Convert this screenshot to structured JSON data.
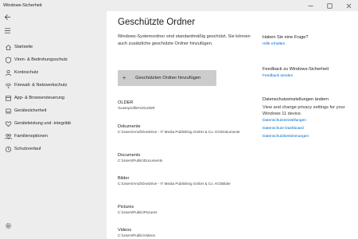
{
  "window": {
    "title": "Windows-Sicherheit"
  },
  "sidebar": {
    "items": [
      {
        "label": "Startseite",
        "icon": "home-icon"
      },
      {
        "label": "Viren- & Bedrohungsschutz",
        "icon": "shield-icon"
      },
      {
        "label": "Kontoschutz",
        "icon": "person-icon"
      },
      {
        "label": "Firewall- & Netzwerkschutz",
        "icon": "wifi-icon"
      },
      {
        "label": "App- & Browsersteuerung",
        "icon": "app-icon"
      },
      {
        "label": "Gerätesicherheit",
        "icon": "laptop-icon"
      },
      {
        "label": "Geräteleistung und -integrität",
        "icon": "heart-icon"
      },
      {
        "label": "Familienoptionen",
        "icon": "family-icon"
      },
      {
        "label": "Schutzverlauf",
        "icon": "history-icon"
      }
    ]
  },
  "main": {
    "title": "Geschützte Ordner",
    "description": "Windows-Systemordner sind standardmäßig geschützt. Sie können auch zusätzliche geschützte Ordner hinzufügen.",
    "add_button": "Geschützten Ordner hinzufügen",
    "folders": [
      {
        "name": "OLDER",
        "path": "%userprofile%\\OLDER"
      },
      {
        "name": "Dokumente",
        "path": "C:\\Users\\Amd\\OneDrive - IT Media Publishing GmbH & Co. KG\\Dokumente"
      },
      {
        "name": "Documents",
        "path": "C:\\Users\\Public\\Documents"
      },
      {
        "name": "Bilder",
        "path": "C:\\Users\\Amd\\OneDrive - IT Media Publishing GmbH & Co. KG\\Bilder"
      },
      {
        "name": "Pictures",
        "path": "C:\\Users\\Public\\Pictures"
      },
      {
        "name": "Videos",
        "path": "C:\\Users\\Public\\Videos"
      }
    ]
  },
  "right": {
    "question_heading": "Haben Sie eine Frage?",
    "help_link": "Hilfe erhalten",
    "feedback_heading": "Feedback zu Windows-Sicherheit",
    "feedback_link": "Feedback senden",
    "privacy_heading": "Datenschutzeinstellungen ändern",
    "privacy_text": "View and change privacy settings for your Windows 11 device.",
    "privacy_links": [
      "Datenschutzeinstellungen",
      "Datenschutz-Dashboard",
      "Datenschutzbestimmungen"
    ]
  },
  "colors": {
    "accent": "#0067c0",
    "sidebar_bg": "#ededed",
    "button_bg": "#cccccc"
  }
}
